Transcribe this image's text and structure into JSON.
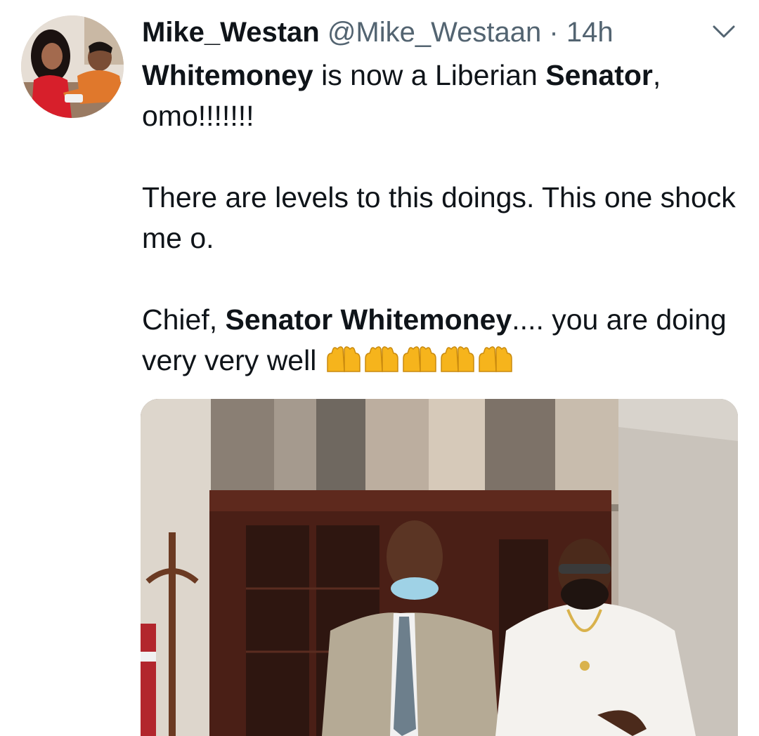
{
  "tweet": {
    "display_name": "Mike_Westan",
    "handle": "@Mike_Westaan",
    "separator": "·",
    "time": "14h",
    "text": {
      "line1_bold_a": "Whitemoney",
      "line1_normal": " is now a Liberian ",
      "line1_bold_b": "Senator",
      "line1_tail": ", omo!!!!!!!",
      "para2": "There are levels to this doings. This one shock me o.",
      "para3_start": "Chief, ",
      "para3_bold": "Senator Whitemoney",
      "para3_normal": ".... you are doing very very well "
    },
    "emoji": "raising-hands-icon x5",
    "colors": {
      "text": "#0f1419",
      "secondary": "#536471",
      "emoji": "#f6b41c"
    }
  },
  "icons": {
    "more_options": "chevron-down-icon",
    "avatar": "avatar"
  },
  "media": {
    "kind": "photo",
    "description_icon": "photo-two-men-office"
  }
}
